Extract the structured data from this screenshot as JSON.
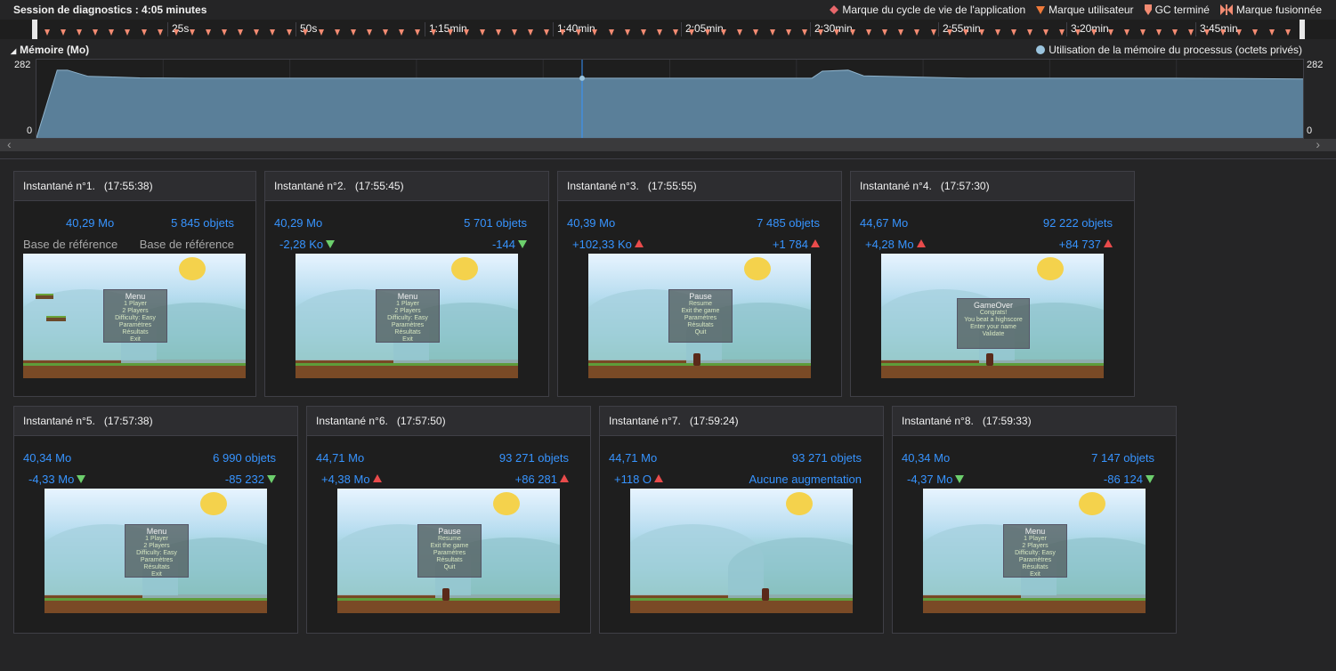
{
  "session": {
    "title": "Session de diagnostics : 4:05 minutes"
  },
  "legend": [
    {
      "label": "Marque du cycle de vie de l'application",
      "icon": "diamond-icon",
      "color": "#e8676b"
    },
    {
      "label": "Marque utilisateur",
      "icon": "triangle-down-icon",
      "color": "#f07a3a"
    },
    {
      "label": "GC terminé",
      "icon": "gc-marker-icon",
      "color": "#f38b72"
    },
    {
      "label": "Marque fusionnée",
      "icon": "merged-marker-icon",
      "color": "#f38b72"
    }
  ],
  "ruler": {
    "ticks": [
      "25s",
      "50s",
      "1:15min",
      "1:40min",
      "2:05min",
      "2:30min",
      "2:55min",
      "3:20min",
      "3:45min"
    ]
  },
  "memory": {
    "title": "Mémoire (Mo)",
    "legend": "Utilisation de la mémoire du processus (octets privés)",
    "y_max": "282",
    "y_min": "0",
    "color": "#5a7f99"
  },
  "chart_data": {
    "type": "area",
    "x": [
      0,
      4,
      6,
      10,
      14,
      20,
      30,
      60,
      100,
      140,
      150,
      152,
      157,
      160,
      180,
      220,
      245
    ],
    "values": [
      0,
      262,
      262,
      238,
      236,
      232,
      231,
      231,
      231,
      231,
      231,
      258,
      262,
      240,
      231,
      231,
      228
    ],
    "ylim": [
      0,
      282
    ],
    "xlim": [
      0,
      245
    ],
    "ylabel": "Mémoire (Mo)"
  },
  "snapshots": [
    {
      "title": "Instantané n°1.",
      "time": "(17:55:38)",
      "size": "40,29 Mo",
      "objects": "5 845 objets",
      "size_diff": "Base de référence",
      "obj_diff": "Base de référence",
      "size_dir": "none",
      "obj_dir": "none",
      "screen": "Menu",
      "screen_lines": [
        "1 Player",
        "2 Players",
        "Difficulty: Easy",
        "Paramètres",
        "Résultats",
        "Exit"
      ]
    },
    {
      "title": "Instantané n°2.",
      "time": "(17:55:45)",
      "size": "40,29 Mo",
      "objects": "5 701 objets",
      "size_diff": "-2,28 Ko",
      "obj_diff": "-144",
      "size_dir": "down",
      "obj_dir": "down",
      "screen": "Menu",
      "screen_lines": [
        "1 Player",
        "2 Players",
        "Difficulty: Easy",
        "Paramètres",
        "Résultats",
        "Exit"
      ]
    },
    {
      "title": "Instantané n°3.",
      "time": "(17:55:55)",
      "size": "40,39 Mo",
      "objects": "7 485 objets",
      "size_diff": "+102,33 Ko",
      "obj_diff": "+1 784",
      "size_dir": "up",
      "obj_dir": "up",
      "screen": "Pause",
      "screen_lines": [
        "Resume",
        "Exit the game",
        "Paramètres",
        "Résultats",
        "Quit"
      ]
    },
    {
      "title": "Instantané n°4.",
      "time": "(17:57:30)",
      "size": "44,67 Mo",
      "objects": "92 222 objets",
      "size_diff": "+4,28 Mo",
      "obj_diff": "+84 737",
      "size_dir": "up",
      "obj_dir": "up",
      "screen": "GameOver",
      "screen_lines": [
        "Congrats!",
        "You beat a highscore",
        "Enter your name",
        "Validate"
      ]
    },
    {
      "title": "Instantané n°5.",
      "time": "(17:57:38)",
      "size": "40,34 Mo",
      "objects": "6 990 objets",
      "size_diff": "-4,33 Mo",
      "obj_diff": "-85 232",
      "size_dir": "down",
      "obj_dir": "down",
      "screen": "Menu",
      "screen_lines": [
        "1 Player",
        "2 Players",
        "Difficulty: Easy",
        "Paramètres",
        "Résultats",
        "Exit"
      ]
    },
    {
      "title": "Instantané n°6.",
      "time": "(17:57:50)",
      "size": "44,71 Mo",
      "objects": "93 271 objets",
      "size_diff": "+4,38 Mo",
      "obj_diff": "+86 281",
      "size_dir": "up",
      "obj_dir": "up",
      "screen": "Pause",
      "screen_lines": [
        "Resume",
        "Exit the game",
        "Paramètres",
        "Résultats",
        "Quit"
      ]
    },
    {
      "title": "Instantané n°7.",
      "time": "(17:59:24)",
      "size": "44,71 Mo",
      "objects": "93 271 objets",
      "size_diff": "+118 O",
      "obj_diff": "Aucune augmentation",
      "size_dir": "up",
      "obj_dir": "none",
      "screen": "",
      "screen_lines": []
    },
    {
      "title": "Instantané n°8.",
      "time": "(17:59:33)",
      "size": "40,34 Mo",
      "objects": "7 147 objets",
      "size_diff": "-4,37 Mo",
      "obj_diff": "-86 124",
      "size_dir": "down",
      "obj_dir": "down",
      "screen": "Menu",
      "screen_lines": [
        "1 Player",
        "2 Players",
        "Difficulty: Easy",
        "Paramètres",
        "Résultats",
        "Exit"
      ]
    }
  ]
}
